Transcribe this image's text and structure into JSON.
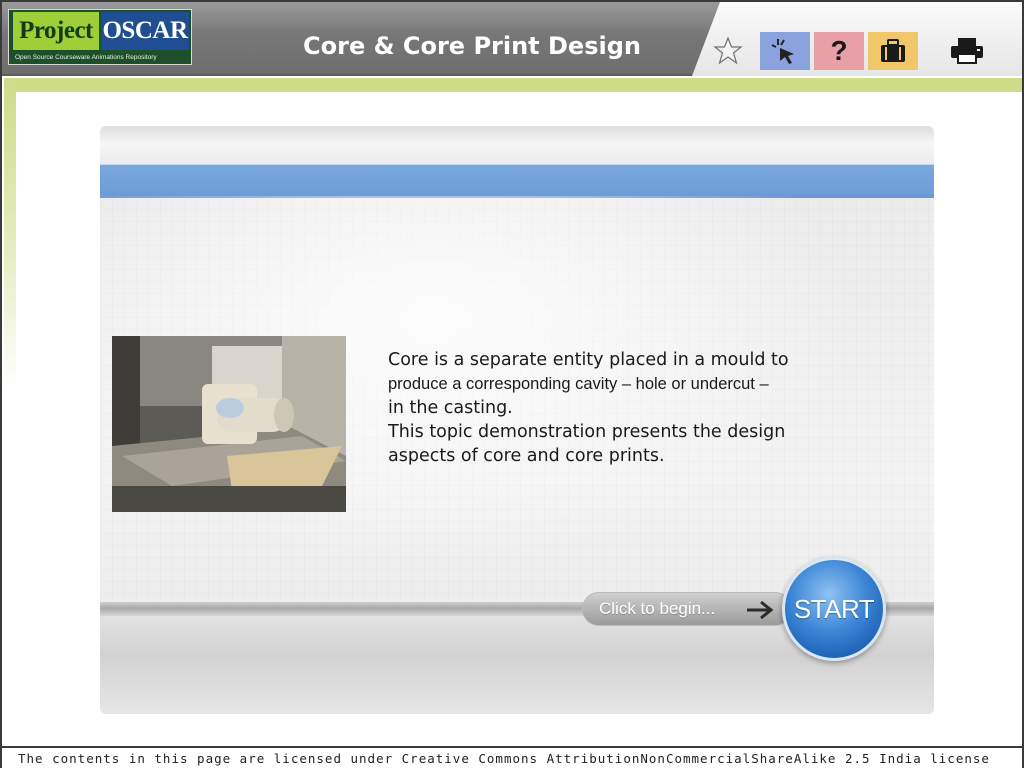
{
  "header": {
    "logo": {
      "word1": "Project",
      "word2": "OSCAR",
      "tagline": "Open Source Courseware Animations Repository"
    },
    "title": "Core & Core Print Design",
    "toolbar": [
      {
        "name": "star-icon"
      },
      {
        "name": "pointer-icon"
      },
      {
        "name": "help-icon"
      },
      {
        "name": "briefcase-icon"
      },
      {
        "name": "printer-icon"
      }
    ]
  },
  "content": {
    "intro_line1": "Core is a separate entity placed in a mould to",
    "intro_line2": "produce a corresponding cavity – hole or undercut –",
    "intro_line3": "in the casting.",
    "intro_line4": "This topic demonstration presents the design",
    "intro_line5": "aspects of core and core prints.",
    "click_label": "Click to begin...",
    "start_label": "START"
  },
  "footer": {
    "license": "The contents in this page are licensed under Creative Commons AttributionNonCommercialShareAlike 2.5 India license"
  },
  "colors": {
    "accent_blue": "#6b9bd6",
    "start_blue": "#2f79cc",
    "band_green": "#cfdc88"
  }
}
